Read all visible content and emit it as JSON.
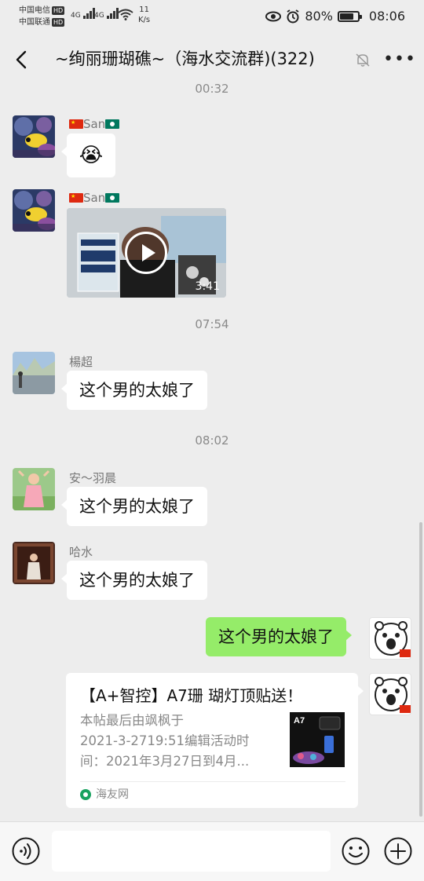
{
  "status": {
    "carrier1": "中国电信",
    "carrier2": "中国联通",
    "hd": "HD",
    "signal": "4G",
    "net_speed": "11",
    "net_unit": "K/s",
    "battery": "80%",
    "battery_level": 0.8,
    "time": "08:06"
  },
  "nav": {
    "title": "~绚丽珊瑚礁~（海水交流群)(322)"
  },
  "messages": {
    "t1": "00:32",
    "san1_name": "San",
    "san1_emoji": "😭",
    "san2_name": "San",
    "video_duration": "3:41",
    "t2": "07:54",
    "yang_name": "楊超",
    "yang_text": "这个男的太娘了",
    "t3": "08:02",
    "an_name": "安～羽晨",
    "an_text": "这个男的太娘了",
    "ha_name": "哈水",
    "ha_text": "这个男的太娘了",
    "me_text": "这个男的太娘了",
    "card": {
      "title": "【A+智控】A7珊 瑚灯顶贴送！",
      "desc1": "本帖最后由飒枫于",
      "desc2": "2021-3-2719:51编辑活动时",
      "desc3": "间：2021年3月27日到4月...",
      "thumb_label": "A7",
      "source": "海友网"
    }
  },
  "colors": {
    "background": "#ededed",
    "my_bubble": "#95ec69",
    "bubble": "#ffffff"
  }
}
